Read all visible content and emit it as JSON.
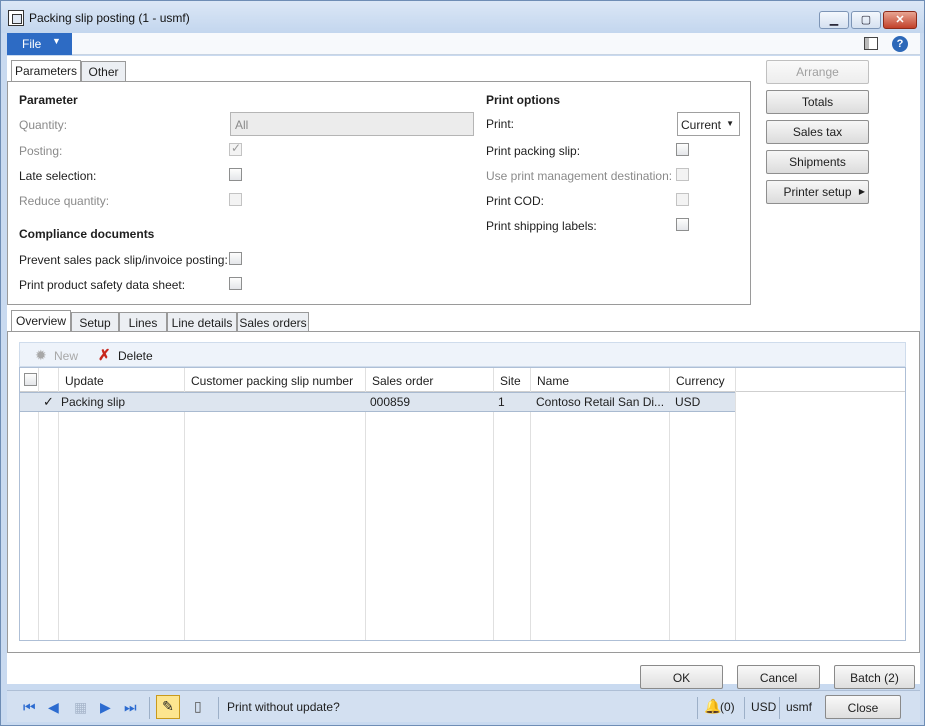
{
  "window": {
    "title": "Packing slip posting (1 - usmf)"
  },
  "menu": {
    "file_label": "File"
  },
  "top_tabs": [
    "Parameters",
    "Other"
  ],
  "parameters": {
    "heading": "Parameter",
    "quantity_label": "Quantity:",
    "quantity_value": "All",
    "posting_label": "Posting:",
    "late_selection_label": "Late selection:",
    "reduce_quantity_label": "Reduce quantity:",
    "compliance_heading": "Compliance documents",
    "prevent_label": "Prevent sales pack slip/invoice posting:",
    "safety_label": "Print product safety data sheet:"
  },
  "print_options": {
    "heading": "Print options",
    "print_label": "Print:",
    "print_value": "Current",
    "packing_slip_label": "Print packing slip:",
    "print_mgmt_label": "Use print management destination:",
    "cod_label": "Print COD:",
    "shipping_labels_label": "Print shipping labels:"
  },
  "side_buttons": {
    "arrange": "Arrange",
    "totals": "Totals",
    "sales_tax": "Sales tax",
    "shipments": "Shipments",
    "printer_setup": "Printer setup"
  },
  "bottom_tabs": [
    "Overview",
    "Setup",
    "Lines",
    "Line details",
    "Sales orders"
  ],
  "grid_toolbar": {
    "new_label": "New",
    "delete_label": "Delete"
  },
  "grid": {
    "columns": [
      "Update",
      "Customer packing slip number",
      "Sales order",
      "Site",
      "Name",
      "Currency"
    ],
    "rows": [
      {
        "update": "Packing slip",
        "customer_packing_slip": "",
        "sales_order": "000859",
        "site": "1",
        "name": "Contoso Retail San Di...",
        "currency": "USD"
      }
    ]
  },
  "dialog_buttons": {
    "ok": "OK",
    "cancel": "Cancel",
    "batch": "Batch (2)"
  },
  "statusbar": {
    "message": "Print without update?",
    "notifications": "(0)",
    "currency": "USD",
    "company": "usmf",
    "close_label": "Close"
  }
}
